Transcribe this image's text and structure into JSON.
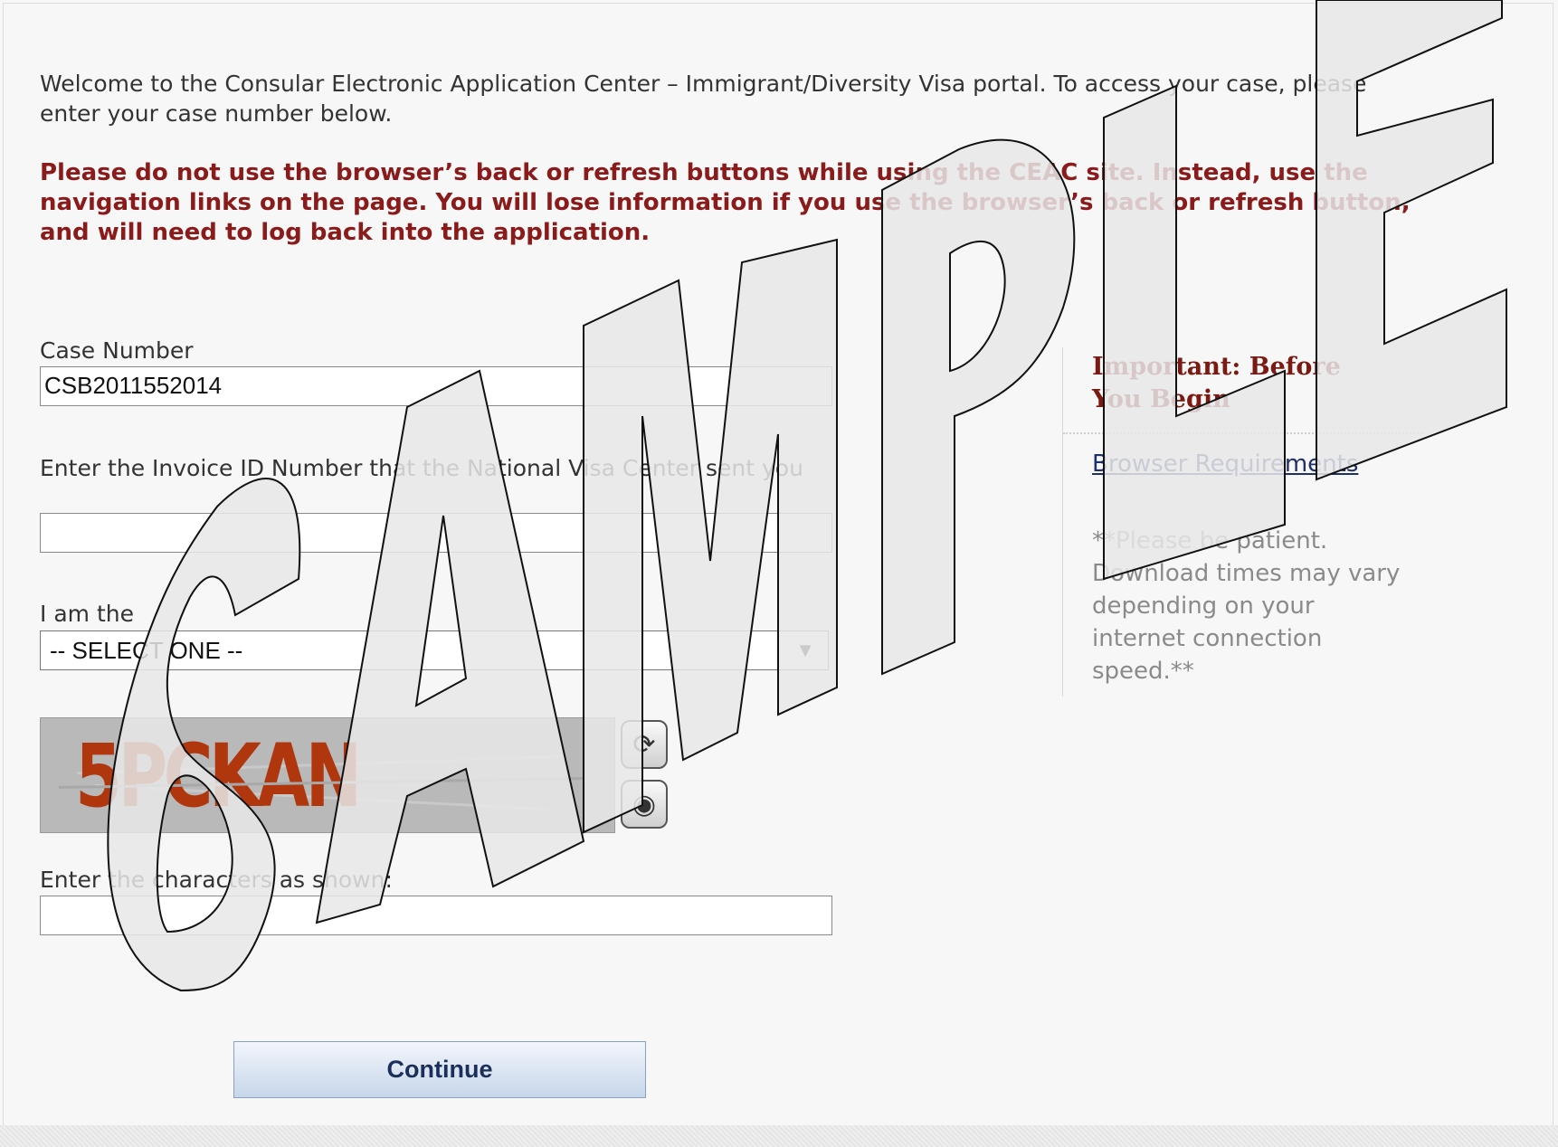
{
  "intro_text": "Welcome to the Consular Electronic Application Center – Immigrant/Diversity Visa portal. To access your case, please enter your case number below.",
  "warning_text": "Please do not use the browser’s back or refresh buttons while using the CEAC site. Instead, use the navigation links on the page. You will lose information if you use the browser’s back or refresh button, and will need to log back into the application.",
  "form": {
    "case_number_label": "Case Number",
    "case_number_value": "CSB2011552014",
    "invoice_label": "Enter the Invoice ID Number that the National Visa Center sent you",
    "invoice_value": "",
    "role_label": "I am the",
    "role_selected": "-- SELECT ONE --",
    "role_arrow": "▼",
    "captcha_text": "5PCKAN",
    "captcha_label": "Enter the characters as shown:",
    "captcha_value": "",
    "continue_label": "Continue",
    "refresh_icon": "refresh-icon",
    "audio_icon": "audio-icon"
  },
  "sidebar": {
    "heading": "Important: Before You Begin",
    "link": "Browser Requirements",
    "note": "**Please be patient. Download times may vary depending on your internet connection speed.**"
  },
  "watermark": "SAMPLE",
  "colors": {
    "warning": "#8b1a1a",
    "heading": "#7a1a12",
    "link": "#1f2f6b",
    "captcha_ink": "#b0360e"
  }
}
